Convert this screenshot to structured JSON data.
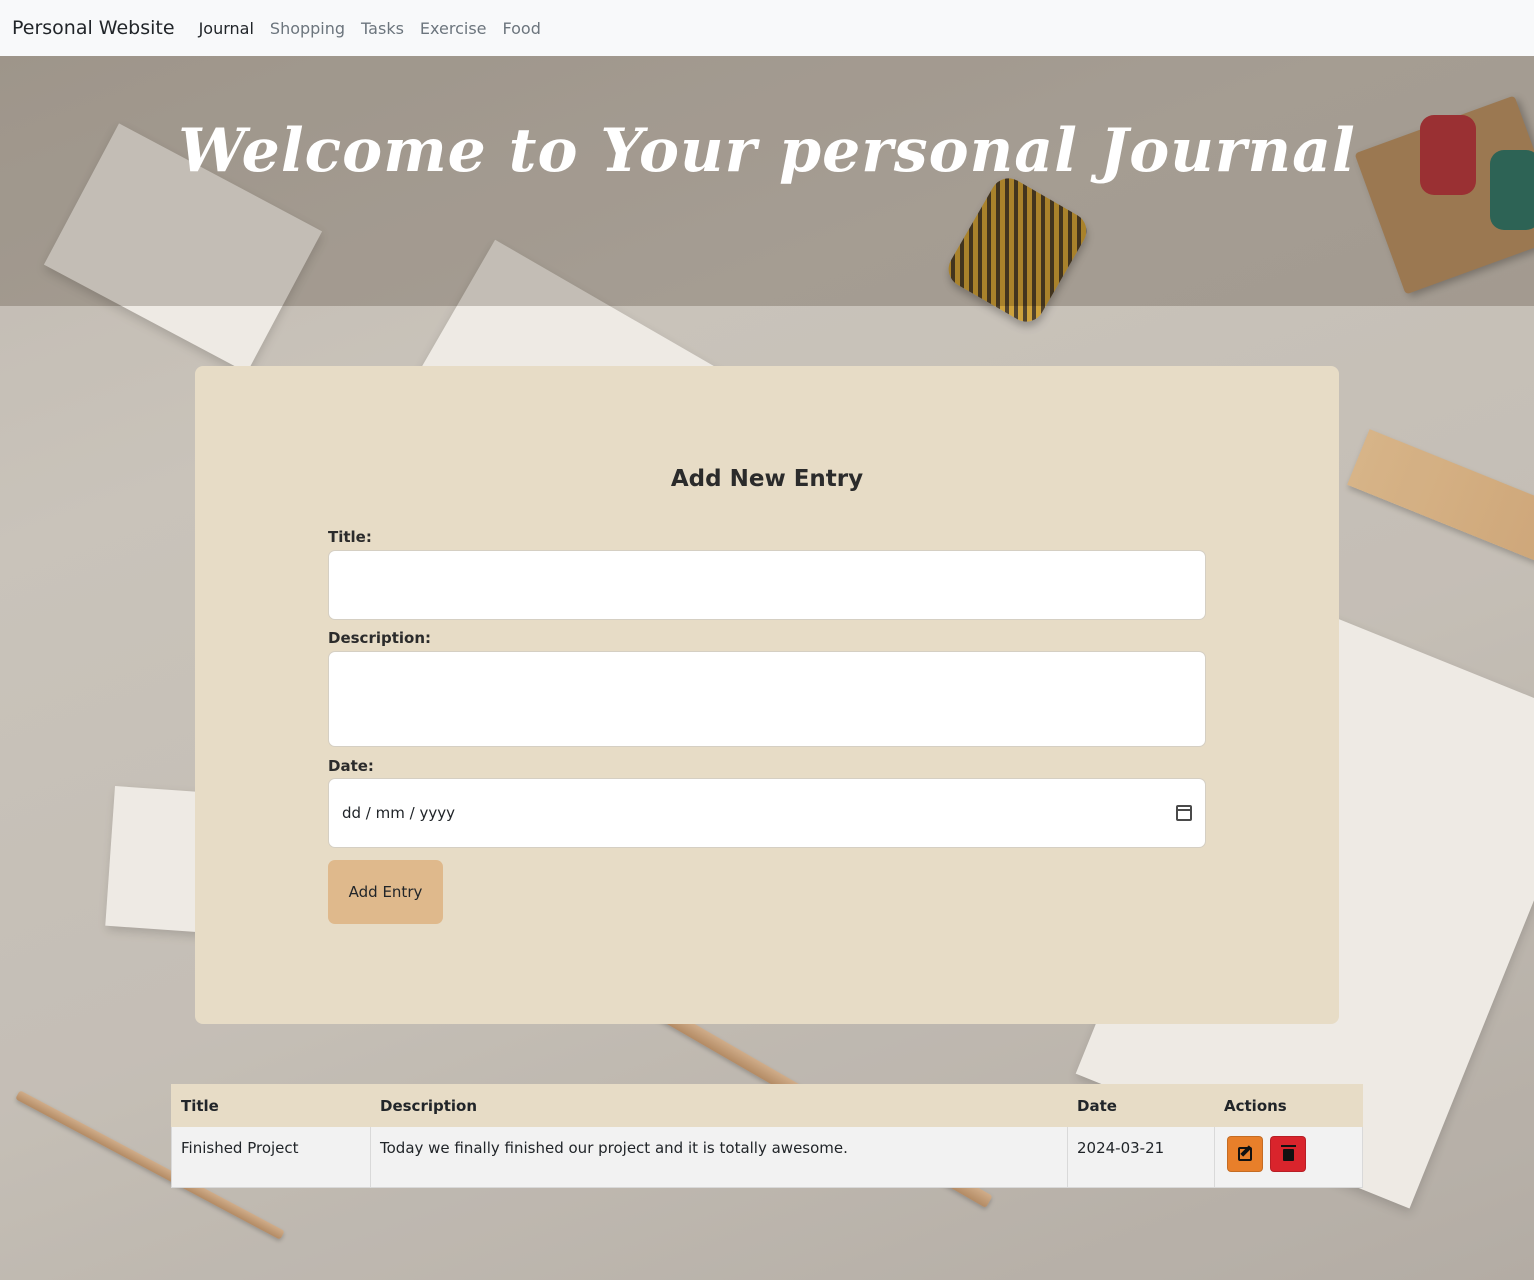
{
  "navbar": {
    "brand": "Personal Website",
    "links": [
      "Journal",
      "Shopping",
      "Tasks",
      "Exercise",
      "Food"
    ],
    "active": "Journal"
  },
  "hero": {
    "title": "Welcome to Your personal Journal"
  },
  "form": {
    "heading": "Add New Entry",
    "title_label": "Title:",
    "title_value": "",
    "description_label": "Description:",
    "description_value": "",
    "date_label": "Date:",
    "date_placeholder": "dd / mm / yyyy",
    "submit_label": "Add Entry"
  },
  "table": {
    "headers": [
      "Title",
      "Description",
      "Date",
      "Actions"
    ],
    "rows": [
      {
        "title": "Finished Project",
        "description": "Today we finally finished our project and it is totally awesome.",
        "date": "2024-03-21",
        "actions": [
          "edit-icon",
          "trash-icon"
        ]
      }
    ]
  },
  "colors": {
    "card_bg": "#e7dcc6",
    "add_button": "#dfb98c",
    "edit_button": "#e87f2a",
    "delete_button": "#d9242c"
  }
}
